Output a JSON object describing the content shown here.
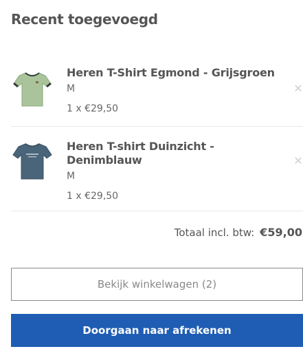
{
  "minicart": {
    "title": "Recent toegevoegd",
    "items": [
      {
        "name": "Heren T-Shirt Egmond - Grijsgroen",
        "variant": "M",
        "quantity_price": "1 x €29,50",
        "remove_icon": "close-icon",
        "image_icon": "tshirt-icon",
        "image_color": "#a9c49b"
      },
      {
        "name": "Heren T-shirt Duinzicht - Denimblauw",
        "variant": "M",
        "quantity_price": "1 x €29,50",
        "remove_icon": "close-icon",
        "image_icon": "tshirt-icon",
        "image_color": "#4a6479"
      }
    ],
    "total_label": "Totaal incl. btw:",
    "total_value": "€59,00",
    "view_cart_label": "Bekijk winkelwagen (2)",
    "checkout_label": "Doorgaan naar afrekenen"
  },
  "colors": {
    "accent": "#1e5db3",
    "text": "#555555",
    "muted": "#888888"
  }
}
